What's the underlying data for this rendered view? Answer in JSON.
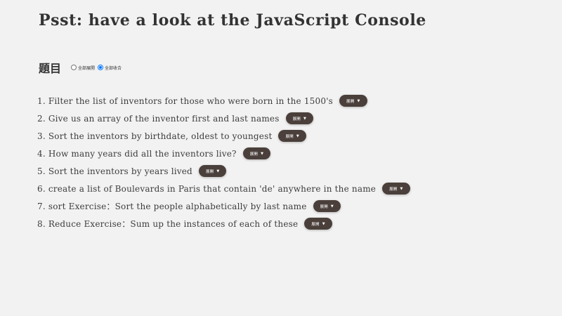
{
  "page": {
    "title": "Psst: have a look at the JavaScript Console"
  },
  "section": {
    "title": "題目",
    "radios": [
      {
        "label": "全部展開",
        "checked": false
      },
      {
        "label": "全部收合",
        "checked": true
      }
    ]
  },
  "exercises": [
    {
      "num": "1.",
      "text": "Filter the list of inventors for those who were born in the 1500's",
      "button": "展開",
      "icon": "caret-down-icon"
    },
    {
      "num": "2.",
      "text": "Give us an array of the inventor first and last names",
      "button": "展開",
      "icon": "caret-down-icon"
    },
    {
      "num": "3.",
      "text": "Sort the inventors by birthdate, oldest to youngest",
      "button": "展開",
      "icon": "caret-down-icon"
    },
    {
      "num": "4.",
      "text": "How many years did all the inventors live?",
      "button": "展開",
      "icon": "caret-down-icon"
    },
    {
      "num": "5.",
      "text": "Sort the inventors by years lived",
      "button": "展開",
      "icon": "caret-down-icon"
    },
    {
      "num": "6.",
      "text": "create a list of Boulevards in Paris that contain 'de' anywhere in the name",
      "button": "展開",
      "icon": "caret-down-icon"
    },
    {
      "num": "7.",
      "text": "sort Exercise：Sort the people alphabetically by last name",
      "button": "展開",
      "icon": "caret-down-icon"
    },
    {
      "num": "8.",
      "text": "Reduce Exercise：Sum up the instances of each of these",
      "button": "展開",
      "icon": "caret-down-icon"
    }
  ],
  "colors": {
    "background": "#f2f2f2",
    "button_bg": "#4a3f3a",
    "radio_accent": "#0075ff"
  }
}
